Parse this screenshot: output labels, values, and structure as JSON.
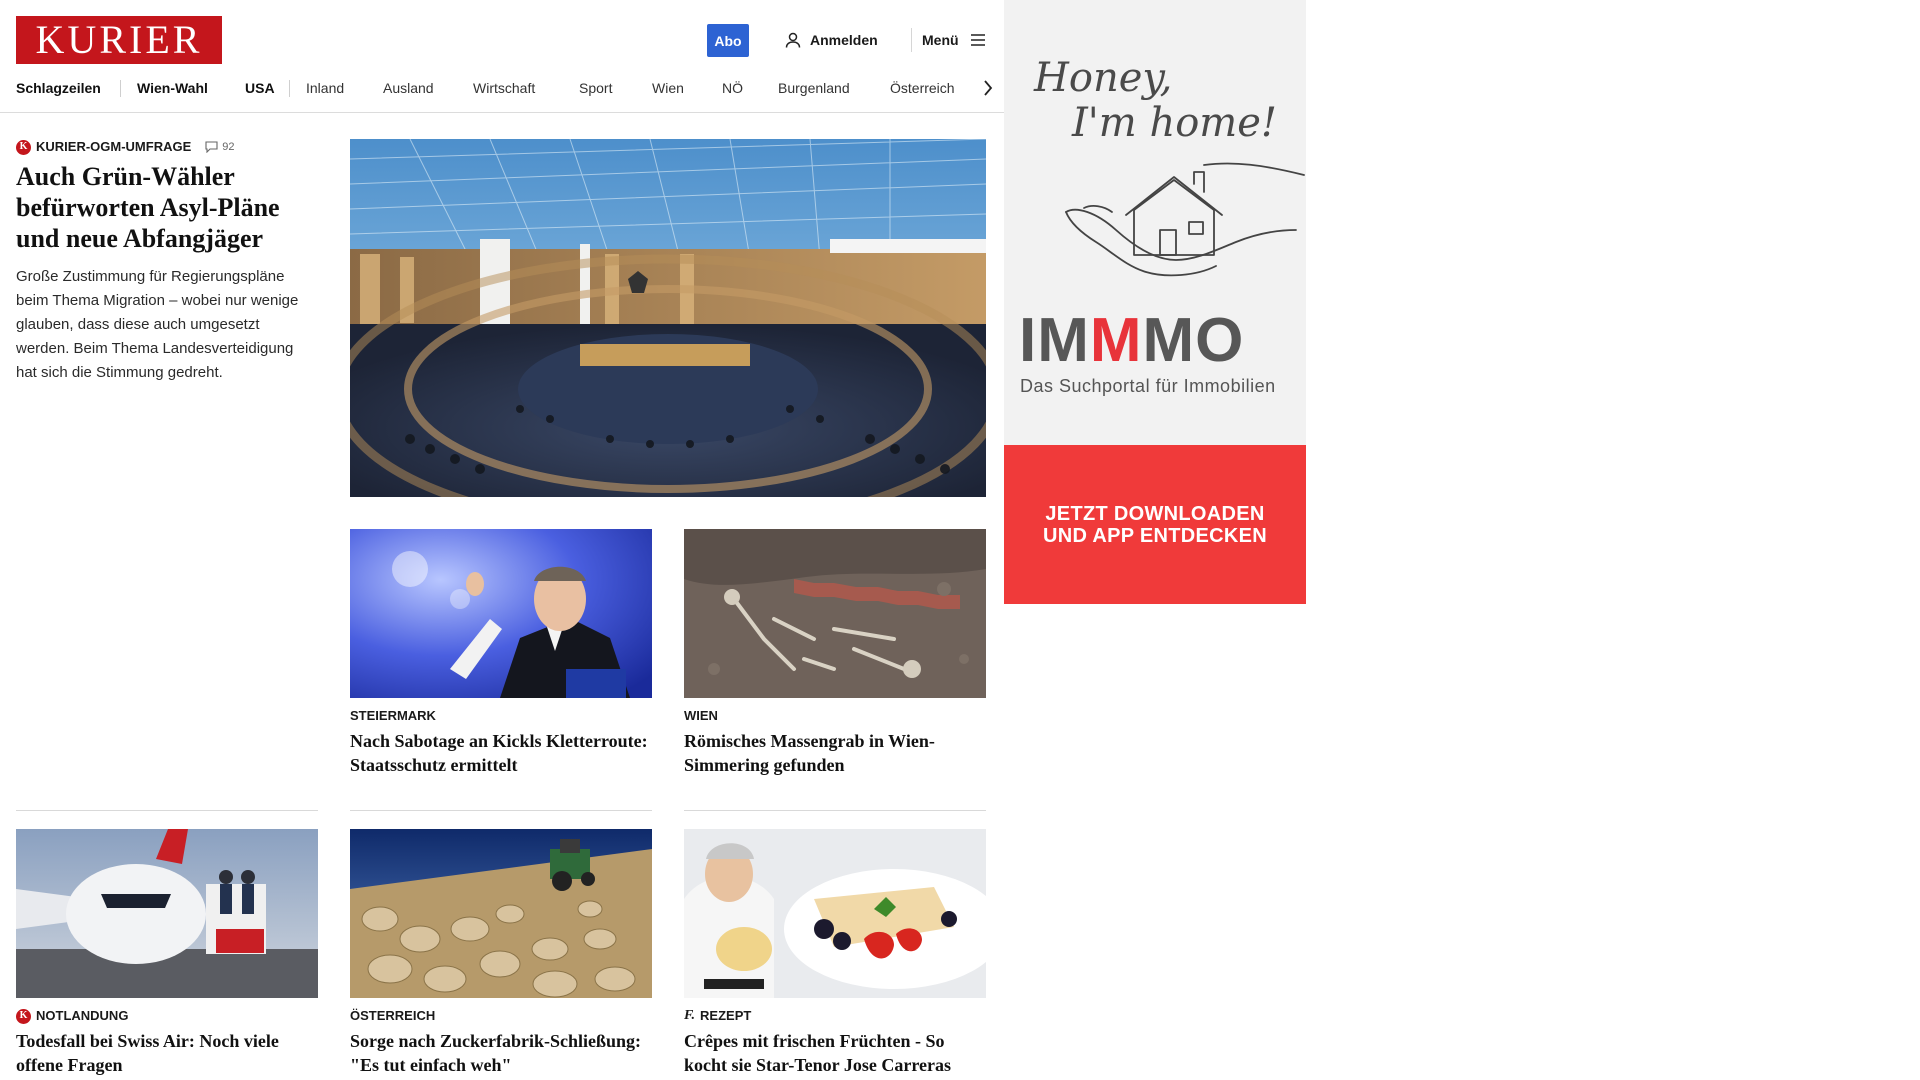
{
  "header": {
    "logo": "KURIER",
    "abo_label": "Abo",
    "login_label": "Anmelden",
    "menu_label": "Menü"
  },
  "nav": {
    "items": [
      "Schlagzeilen",
      "Wien-Wahl",
      "USA",
      "Inland",
      "Ausland",
      "Wirtschaft",
      "Sport",
      "Wien",
      "NÖ",
      "Burgenland",
      "Österreich"
    ]
  },
  "lead": {
    "kicker": "KURIER-OGM-UMFRAGE",
    "badge": "K",
    "comments": "92",
    "headline": "Auch Grün-Wähler befürworten Asyl-Pläne und neue Abfangjäger",
    "teaser": "Große Zustimmung für Regierungspläne beim Thema Migration – wobei nur wenige glauben, dass diese auch umgesetzt werden. Beim Thema Landesverteidigung hat sich die Stimmung gedreht."
  },
  "cards": [
    {
      "kicker": "STEIERMARK",
      "headline": "Nach Sabotage an Kickls Kletterroute: Staatsschutz ermittelt"
    },
    {
      "kicker": "WIEN",
      "headline": "Römisches Massengrab in Wien-Simmering gefunden"
    },
    {
      "kicker": "NOTLANDUNG",
      "badge": "K",
      "headline": "Todesfall bei Swiss Air: Noch viele offene Fragen"
    },
    {
      "kicker": "ÖSTERREICH",
      "headline": "Sorge nach Zuckerfabrik-Schließung: \"Es tut einfach weh\""
    },
    {
      "kicker": "REZEPT",
      "icon_glyph": "f.",
      "headline": "Crêpes mit frischen Früchten - So kocht sie Star-Tenor Jose Carreras"
    }
  ],
  "ad": {
    "script_line1": "Honey,",
    "script_line2": "I'm home!",
    "brand_a": "IM",
    "brand_b": "M",
    "brand_c": "MO",
    "tagline": "Das Suchportal für Immobilien",
    "cta_line1": "JETZT DOWNLOADEN",
    "cta_line2": "UND APP ENTDECKEN"
  },
  "colors": {
    "brand_red": "#c4161c",
    "abo_blue": "#2d63d3",
    "ad_red": "#f03a3a",
    "ad_accent_red": "#e8333a"
  }
}
